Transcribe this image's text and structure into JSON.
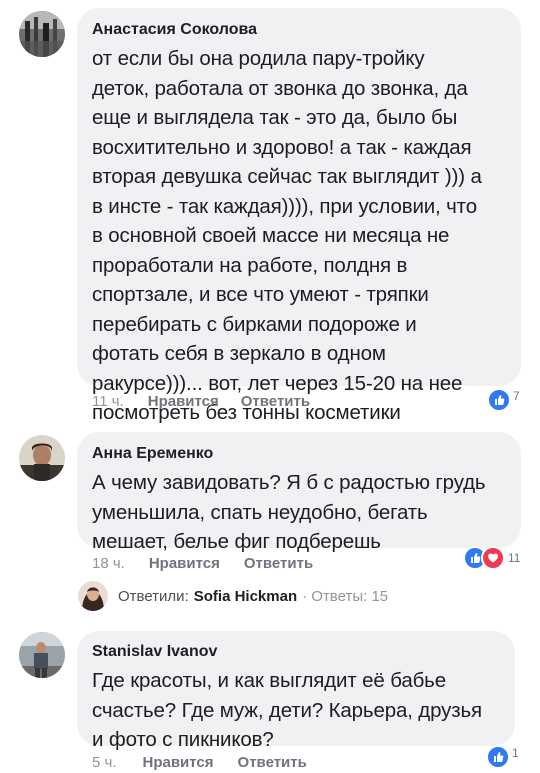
{
  "comments": [
    {
      "author": "Анастасия Соколова",
      "lines": [
        "от если бы она родила пару-тройку",
        "деток, работала от звонка до звонка, да",
        "еще и выглядела так - это да, было бы",
        "восхитительно и здорово! а так - каждая",
        "вторая девушка сейчас так выглядит ))) а",
        "в инсте - так каждая)))), при условии, что",
        "в основной своей массе ни месяца не",
        "проработали на работе, полдня в",
        "спортзале, и все что умеют - тряпки",
        "перебирать с бирками подороже и",
        "фотать себя в зеркало в одном",
        "ракурсе)))... вот, лет через 15-20 на нее",
        "посмотреть без тонны косметики"
      ],
      "time": "11 ч.",
      "like_label": "Нравится",
      "reply_label": "Ответить",
      "reaction_count": "7"
    },
    {
      "author": "Анна Еременко",
      "lines": [
        "А чему завидовать? Я б с радостью грудь",
        "уменьшила, спать неудобно, бегать",
        "мешает, белье фиг подберешь"
      ],
      "time": "18 ч.",
      "like_label": "Нравится",
      "reply_label": "Ответить",
      "reaction_count": "11",
      "replies": {
        "prefix": "Ответили:",
        "name": "Sofia Hickman",
        "count": "· Ответы: 15"
      }
    },
    {
      "author": "Stanislav Ivanov",
      "lines": [
        "Где красоты, и как выглядит её бабье",
        "счастье? Где муж, дети? Карьера, друзья",
        "и фото с пикников?"
      ],
      "time": "5 ч.",
      "like_label": "Нравится",
      "reply_label": "Ответить",
      "reaction_count": "1"
    }
  ],
  "colors": {
    "bubble": "#f0f1f3",
    "like": "#2f79f4",
    "love": "#f0394f",
    "meta": "#90949c"
  },
  "icons": [
    "thumbs-up-icon",
    "heart-icon"
  ]
}
